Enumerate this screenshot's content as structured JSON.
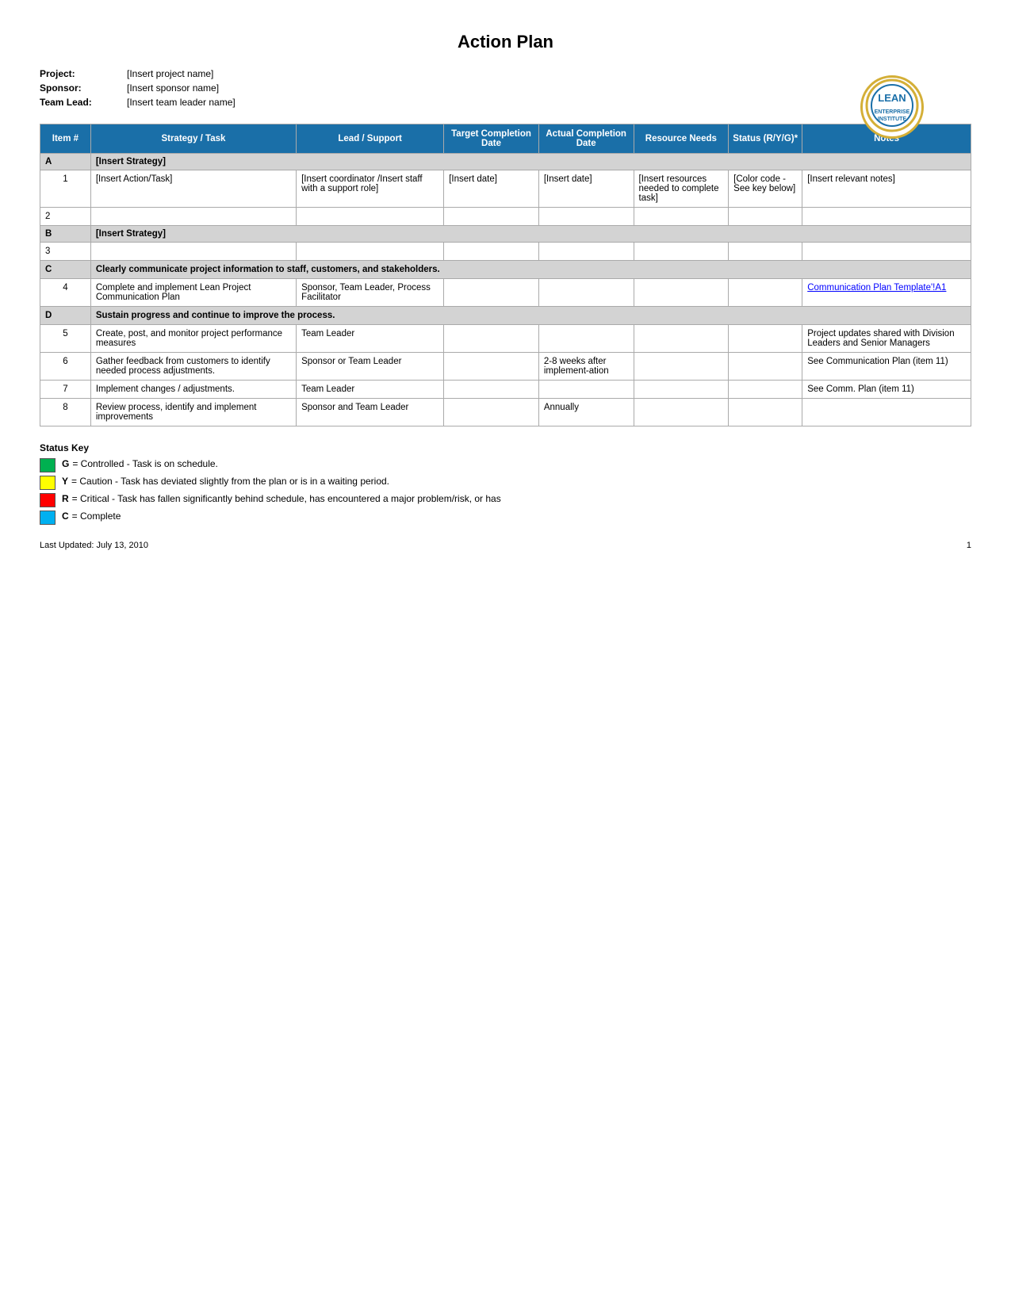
{
  "page": {
    "title": "Action Plan",
    "meta": {
      "project_label": "Project:",
      "project_value": "[Insert project name]",
      "sponsor_label": "Sponsor:",
      "sponsor_value": "[Insert sponsor name]",
      "teamlead_label": "Team Lead:",
      "teamlead_value": "[Insert team leader name]"
    },
    "logo_text": "LEAN",
    "table": {
      "headers": [
        {
          "label": "Item #",
          "key": "item_num"
        },
        {
          "label": "Strategy / Task",
          "key": "strategy_task"
        },
        {
          "label": "Lead / Support",
          "key": "lead_support"
        },
        {
          "label": "Target Completion Date",
          "key": "target_date"
        },
        {
          "label": "Actual Completion Date",
          "key": "actual_date"
        },
        {
          "label": "Resource Needs",
          "key": "resource_needs"
        },
        {
          "label": "Status (R/Y/G)*",
          "key": "status"
        },
        {
          "label": "Notes",
          "key": "notes"
        }
      ],
      "rows": [
        {
          "type": "strategy",
          "letter": "A",
          "label": "[Insert Strategy]"
        },
        {
          "type": "data",
          "item": "1",
          "task": "[Insert Action/Task]",
          "lead": "[Insert coordinator /Insert staff with a support role]",
          "target": "[Insert date]",
          "actual": "[Insert date]",
          "resource": "[Insert resources needed to complete task]",
          "status": "[Color code - See key below]",
          "notes": "[Insert relevant notes]"
        },
        {
          "type": "empty",
          "item": "2"
        },
        {
          "type": "strategy",
          "letter": "B",
          "label": "[Insert Strategy]"
        },
        {
          "type": "empty",
          "item": "3"
        },
        {
          "type": "strategy_long",
          "letter": "C",
          "label": "Clearly communicate project information to staff, customers, and stakeholders."
        },
        {
          "type": "data",
          "item": "4",
          "task": "Complete and implement Lean Project Communication Plan",
          "lead": "Sponsor, Team Leader, Process Facilitator",
          "target": "",
          "actual": "",
          "resource": "",
          "status": "",
          "notes": "Communication Plan Template'!A1"
        },
        {
          "type": "strategy_long",
          "letter": "D",
          "label": "Sustain progress and continue to improve the process."
        },
        {
          "type": "data",
          "item": "5",
          "task": "Create, post, and monitor project performance measures",
          "lead": "Team Leader",
          "target": "",
          "actual": "",
          "resource": "",
          "status": "",
          "notes": "Project updates shared with Division Leaders and Senior Managers"
        },
        {
          "type": "data",
          "item": "6",
          "task": "Gather feedback from customers to identify needed process adjustments.",
          "lead": "Sponsor or Team Leader",
          "target": "",
          "actual": "2-8 weeks after implement-ation",
          "resource": "",
          "status": "",
          "notes": "See Communication Plan (item 11)"
        },
        {
          "type": "data",
          "item": "7",
          "task": "Implement changes / adjustments.",
          "lead": "Team Leader",
          "target": "",
          "actual": "",
          "resource": "",
          "status": "",
          "notes": "See Comm. Plan (item 11)"
        },
        {
          "type": "data",
          "item": "8",
          "task": "Review process, identify and implement improvements",
          "lead": "Sponsor and Team Leader",
          "target": "",
          "actual": "Annually",
          "resource": "",
          "status": "",
          "notes": ""
        }
      ]
    },
    "status_key": {
      "title": "Status Key",
      "items": [
        {
          "color": "green",
          "letter": "G",
          "description": "= Controlled - Task is on schedule."
        },
        {
          "color": "yellow",
          "letter": "Y",
          "description": "= Caution - Task has deviated slightly from the plan or is in a waiting period."
        },
        {
          "color": "red",
          "letter": "R",
          "description": "= Critical - Task has fallen significantly behind schedule, has encountered a major problem/risk, or has"
        },
        {
          "color": "cyan",
          "letter": "C",
          "description": "= Complete"
        }
      ]
    },
    "footer": {
      "last_updated": "Last Updated: July 13, 2010",
      "page_number": "1"
    }
  }
}
